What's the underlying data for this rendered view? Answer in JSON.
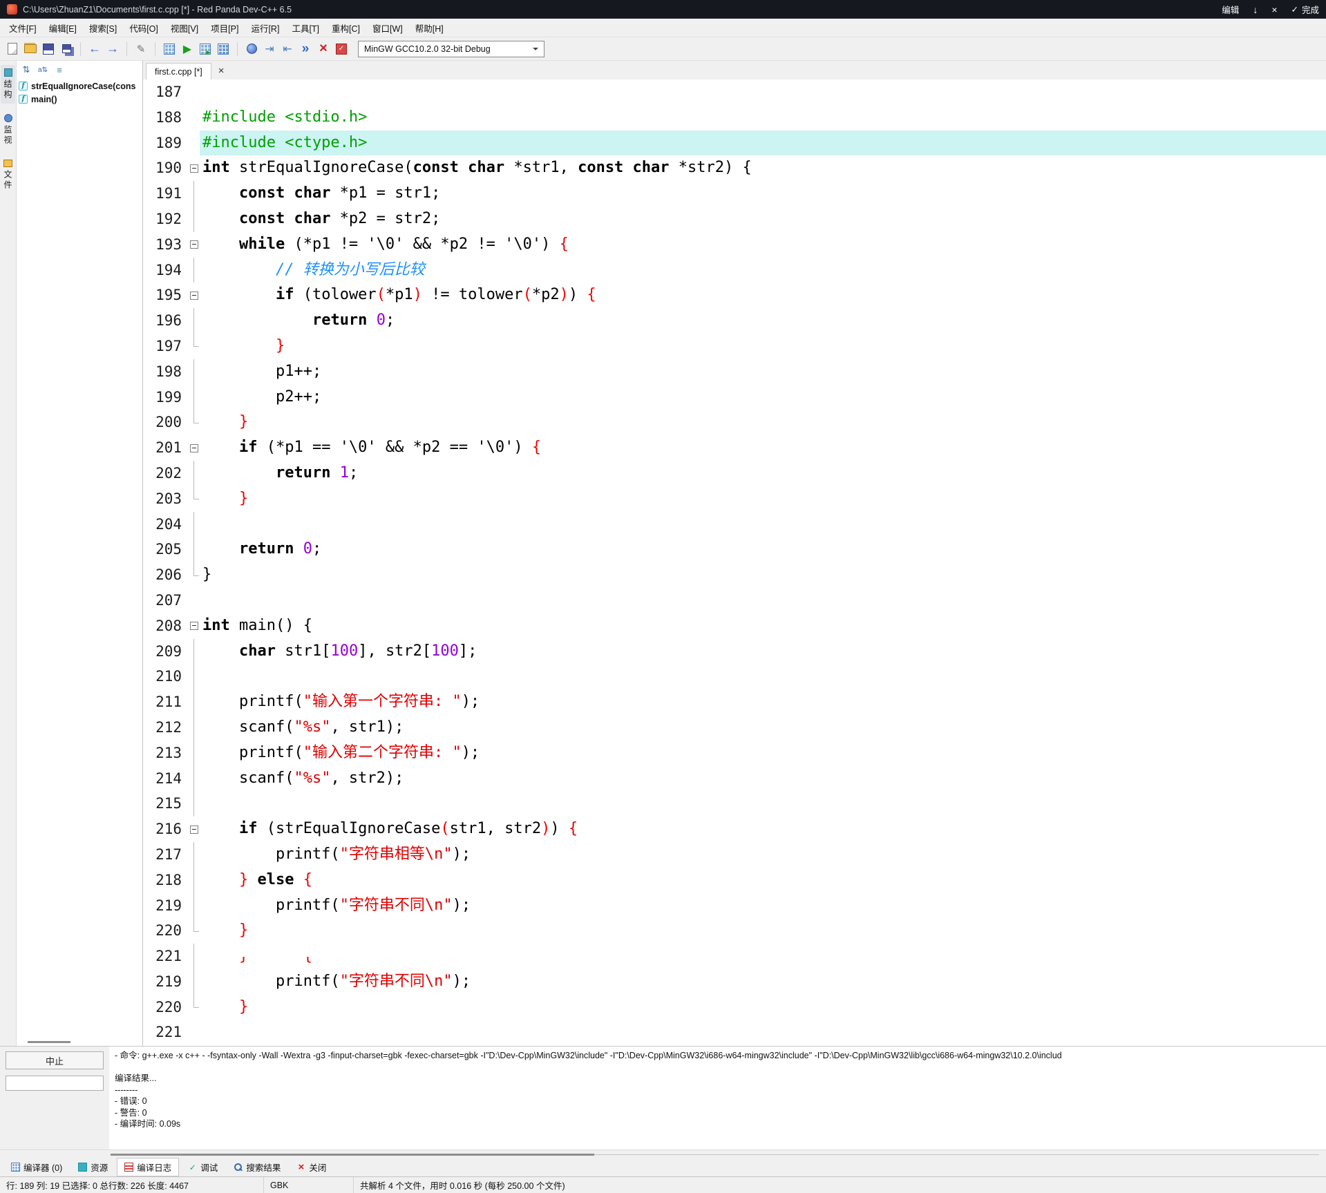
{
  "title_bar": {
    "title": "C:\\Users\\ZhuanZ1\\Documents\\first.c.cpp [*] - Red Panda Dev-C++ 6.5",
    "edit_label": "编辑",
    "done_label": "完成"
  },
  "menu": {
    "items": [
      "文件[F]",
      "编辑[E]",
      "搜索[S]",
      "代码[O]",
      "视图[V]",
      "项目[P]",
      "运行[R]",
      "工具[T]",
      "重构[C]",
      "窗口[W]",
      "帮助[H]"
    ]
  },
  "toolbar": {
    "compiler_set": "MinGW GCC10.2.0 32-bit Debug",
    "items": [
      "new-file-icon",
      "open-file-icon",
      "save-icon",
      "save-all-icon",
      "sep",
      "back-icon",
      "forward-icon",
      "sep",
      "pencil-icon",
      "sep",
      "compile-icon",
      "run-icon",
      "compile-run-icon",
      "rebuild-icon",
      "sep",
      "debug-icon",
      "step-over-icon",
      "step-into-icon",
      "continue-icon",
      "stop-icon",
      "syntax-check-icon",
      "combo"
    ]
  },
  "side_strip": {
    "tabs": [
      {
        "label": "结构",
        "icon": "structure-icon",
        "active": true
      },
      {
        "label": "监视",
        "icon": "watch-icon",
        "active": false
      },
      {
        "label": "文件",
        "icon": "files-icon",
        "active": false
      }
    ]
  },
  "structure_panel": {
    "tools": [
      "sort-by-type-icon",
      "sort-alpha-icon",
      "refresh-icon"
    ],
    "items": [
      {
        "icon": "function-icon",
        "label": "strEqualIgnoreCase(cons"
      },
      {
        "icon": "function-icon",
        "label": "main()"
      }
    ]
  },
  "editor": {
    "tab": "first.c.cpp [*]",
    "lines": [
      [
        "187",
        "",
        0,
        []
      ],
      [
        "188",
        "",
        0,
        [
          [
            "#include <stdio.h>",
            "g"
          ]
        ]
      ],
      [
        "189",
        "",
        1,
        [
          [
            "#include <ctype.h>",
            "g"
          ]
        ]
      ],
      [
        "190",
        "box",
        0,
        [
          [
            "int",
            "k"
          ],
          [
            " strEqualIgnoreCase(",
            "p"
          ],
          [
            "const char",
            "k"
          ],
          [
            " *str1, ",
            "p"
          ],
          [
            "const char",
            "k"
          ],
          [
            " *str2) {",
            "p"
          ]
        ]
      ],
      [
        "191",
        "v",
        0,
        [
          [
            "    ",
            "p"
          ],
          [
            "const char",
            "k"
          ],
          [
            " *p1 = str1;",
            "p"
          ]
        ]
      ],
      [
        "192",
        "v",
        0,
        [
          [
            "    ",
            "p"
          ],
          [
            "const char",
            "k"
          ],
          [
            " *p2 = str2;",
            "p"
          ]
        ]
      ],
      [
        "193",
        "box",
        0,
        [
          [
            "    ",
            "p"
          ],
          [
            "while",
            "k"
          ],
          [
            " (*p1 != '\\0' && *p2 != '\\0') ",
            "p"
          ],
          [
            "{",
            "r"
          ]
        ]
      ],
      [
        "194",
        "v",
        0,
        [
          [
            "        ",
            "p"
          ],
          [
            "// 转换为小写后比较",
            "c"
          ]
        ]
      ],
      [
        "195",
        "box",
        0,
        [
          [
            "        ",
            "p"
          ],
          [
            "if",
            "k"
          ],
          [
            " (tolower",
            "p"
          ],
          [
            "(",
            "r"
          ],
          [
            "*p1",
            "p"
          ],
          [
            ")",
            "r"
          ],
          [
            " != tolower",
            "p"
          ],
          [
            "(",
            "r"
          ],
          [
            "*p2",
            "p"
          ],
          [
            ")",
            "r"
          ],
          [
            ") ",
            "p"
          ],
          [
            "{",
            "r"
          ]
        ]
      ],
      [
        "196",
        "v",
        0,
        [
          [
            "            ",
            "p"
          ],
          [
            "return",
            "k"
          ],
          [
            " ",
            "p"
          ],
          [
            "0",
            "n"
          ],
          [
            ";",
            "p"
          ]
        ]
      ],
      [
        "197",
        "tick",
        0,
        [
          [
            "        ",
            "p"
          ],
          [
            "}",
            "r"
          ]
        ]
      ],
      [
        "198",
        "v",
        0,
        [
          [
            "        ",
            "p"
          ],
          [
            "p1++;",
            "p"
          ]
        ]
      ],
      [
        "199",
        "v",
        0,
        [
          [
            "        ",
            "p"
          ],
          [
            "p2++;",
            "p"
          ]
        ]
      ],
      [
        "200",
        "tick",
        0,
        [
          [
            "    ",
            "p"
          ],
          [
            "}",
            "r"
          ]
        ]
      ],
      [
        "201",
        "box",
        0,
        [
          [
            "    ",
            "p"
          ],
          [
            "if",
            "k"
          ],
          [
            " (*p1 == '\\0' && *p2 == '\\0') ",
            "p"
          ],
          [
            "{",
            "r"
          ]
        ]
      ],
      [
        "202",
        "v",
        0,
        [
          [
            "        ",
            "p"
          ],
          [
            "return",
            "k"
          ],
          [
            " ",
            "p"
          ],
          [
            "1",
            "n"
          ],
          [
            ";",
            "p"
          ]
        ]
      ],
      [
        "203",
        "tick",
        0,
        [
          [
            "    ",
            "p"
          ],
          [
            "}",
            "r"
          ]
        ]
      ],
      [
        "204",
        "v",
        0,
        []
      ],
      [
        "205",
        "v",
        0,
        [
          [
            "    ",
            "p"
          ],
          [
            "return",
            "k"
          ],
          [
            " ",
            "p"
          ],
          [
            "0",
            "n"
          ],
          [
            ";",
            "p"
          ]
        ]
      ],
      [
        "206",
        "end",
        0,
        [
          [
            "}",
            "p"
          ]
        ]
      ],
      [
        "207",
        "",
        0,
        []
      ],
      [
        "208",
        "box",
        0,
        [
          [
            "int",
            "k"
          ],
          [
            " main() {",
            "p"
          ]
        ]
      ],
      [
        "209",
        "v",
        0,
        [
          [
            "    ",
            "p"
          ],
          [
            "char",
            "k"
          ],
          [
            " str1[",
            "p"
          ],
          [
            "100",
            "n"
          ],
          [
            "], str2[",
            "p"
          ],
          [
            "100",
            "n"
          ],
          [
            "];",
            "p"
          ]
        ]
      ],
      [
        "210",
        "v",
        0,
        []
      ],
      [
        "211",
        "v",
        0,
        [
          [
            "    printf(",
            "p"
          ],
          [
            "\"输入第一个字符串: \"",
            "s"
          ],
          [
            ");",
            "p"
          ]
        ]
      ],
      [
        "212",
        "v",
        0,
        [
          [
            "    scanf(",
            "p"
          ],
          [
            "\"%s\"",
            "s"
          ],
          [
            ", str1);",
            "p"
          ]
        ]
      ],
      [
        "213",
        "v",
        0,
        [
          [
            "    printf(",
            "p"
          ],
          [
            "\"输入第二个字符串: \"",
            "s"
          ],
          [
            ");",
            "p"
          ]
        ]
      ],
      [
        "214",
        "v",
        0,
        [
          [
            "    scanf(",
            "p"
          ],
          [
            "\"%s\"",
            "s"
          ],
          [
            ", str2);",
            "p"
          ]
        ]
      ],
      [
        "215",
        "v",
        0,
        []
      ],
      [
        "216",
        "box",
        0,
        [
          [
            "    ",
            "p"
          ],
          [
            "if",
            "k"
          ],
          [
            " (strEqualIgnoreCase",
            "p"
          ],
          [
            "(",
            "r"
          ],
          [
            "str1, str2",
            "p"
          ],
          [
            ")",
            "r"
          ],
          [
            ") ",
            "p"
          ],
          [
            "{",
            "r"
          ]
        ]
      ],
      [
        "217",
        "v",
        0,
        [
          [
            "        printf(",
            "p"
          ],
          [
            "\"字符串相等\\n\"",
            "s"
          ],
          [
            ");",
            "p"
          ]
        ]
      ],
      [
        "218",
        "v",
        0,
        [
          [
            "    ",
            "p"
          ],
          [
            "}",
            "r"
          ],
          [
            " ",
            "p"
          ],
          [
            "else",
            "k"
          ],
          [
            " ",
            "p"
          ],
          [
            "{",
            "r"
          ]
        ]
      ],
      [
        "219",
        "v",
        0,
        [
          [
            "        printf(",
            "p"
          ],
          [
            "\"字符串不同\\n\"",
            "s"
          ],
          [
            ");",
            "p"
          ]
        ]
      ],
      [
        "220",
        "tick",
        0,
        [
          [
            "    ",
            "p"
          ],
          [
            "}",
            "r"
          ]
        ]
      ],
      [
        "221",
        "v",
        2,
        [
          [
            "    ",
            "p"
          ],
          [
            "}",
            "r"
          ],
          [
            " ----",
            "p"
          ],
          [
            " {",
            "r"
          ]
        ]
      ],
      [
        "219",
        "v",
        0,
        [
          [
            "        printf(",
            "p"
          ],
          [
            "\"字符串不同\\n\"",
            "s"
          ],
          [
            ");",
            "p"
          ]
        ]
      ],
      [
        "220",
        "tick",
        0,
        [
          [
            "    ",
            "p"
          ],
          [
            "}",
            "r"
          ]
        ]
      ],
      [
        "221",
        "",
        0,
        []
      ]
    ]
  },
  "compile_log": {
    "abort_label": "中止",
    "lines": [
      "- 命令: g++.exe -x c++ - -fsyntax-only -Wall -Wextra -g3 -finput-charset=gbk -fexec-charset=gbk -I\"D:\\Dev-Cpp\\MinGW32\\include\" -I\"D:\\Dev-Cpp\\MinGW32\\i686-w64-mingw32\\include\" -I\"D:\\Dev-Cpp\\MinGW32\\lib\\gcc\\i686-w64-mingw32\\10.2.0\\includ",
      "",
      "编译结果...",
      "--------",
      "- 错误: 0",
      "- 警告: 0",
      "- 编译时间: 0.09s"
    ]
  },
  "bottom_tabs": {
    "tabs": [
      {
        "label": "编译器 (0)",
        "icon": "compiler-tab-icon",
        "active": false
      },
      {
        "label": "资源",
        "icon": "resources-tab-icon",
        "active": false
      },
      {
        "label": "编译日志",
        "icon": "compile-log-tab-icon",
        "active": true
      },
      {
        "label": "调试",
        "icon": "debug-tab-icon",
        "active": false
      },
      {
        "label": "搜索结果",
        "icon": "search-results-tab-icon",
        "active": false
      },
      {
        "label": "关闭",
        "icon": "close-bottom-icon",
        "active": false
      }
    ]
  },
  "status_bar": {
    "left": "行: 189  列: 19  已选择: 0  总行数: 226  长度: 4467",
    "encoding": "GBK",
    "info": "共解析 4 个文件，用时 0.016 秒 (每秒 250.00 个文件)"
  }
}
